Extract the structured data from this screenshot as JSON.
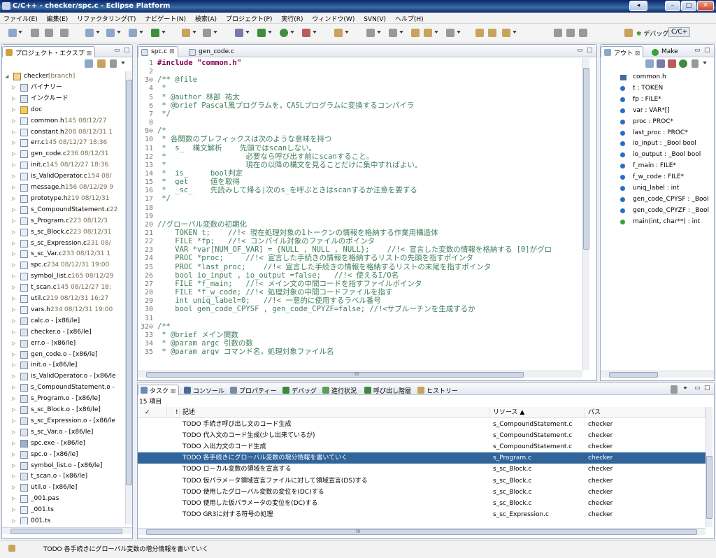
{
  "window": {
    "title": "C/C++ - checker/spc.c - Eclipse Platform",
    "btn_min": "◂",
    "btn_close": "✕"
  },
  "menu": [
    "ファイル(E)",
    "編集(E)",
    "リファクタリング(T)",
    "ナビゲート(N)",
    "検索(A)",
    "プロジェクト(P)",
    "実行(R)",
    "ウィンドウ(W)",
    "SVN(V)",
    "ヘルプ(H)"
  ],
  "perspectives": {
    "debug": "デバッグ",
    "cpp": "C/C+"
  },
  "explorer": {
    "tab": "プロジェクト・エクスプ",
    "items": [
      {
        "label": "checker",
        "deco": " [branch]",
        "indent": 0,
        "icon": "proj",
        "expanded": true
      },
      {
        "label": "バイナリー",
        "deco": "",
        "indent": 1,
        "icon": "bin"
      },
      {
        "label": "インクルード",
        "deco": "",
        "indent": 1,
        "icon": "bin"
      },
      {
        "label": "doc",
        "deco": "",
        "indent": 1,
        "icon": "folder"
      },
      {
        "label": "common.h",
        "deco": " 145  08/12/27",
        "indent": 1,
        "icon": "h"
      },
      {
        "label": "constant.h",
        "deco": " 208  08/12/31 1",
        "indent": 1,
        "icon": "h"
      },
      {
        "label": "err.c",
        "deco": " 145  08/12/27 18:36",
        "indent": 1,
        "icon": "c"
      },
      {
        "label": "gen_code.c",
        "deco": " 236  08/12/31",
        "indent": 1,
        "icon": "c"
      },
      {
        "label": "init.c",
        "deco": " 145  08/12/27 18:36",
        "indent": 1,
        "icon": "c"
      },
      {
        "label": "is_ValidOperator.c",
        "deco": " 154  08/",
        "indent": 1,
        "icon": "c"
      },
      {
        "label": "message.h",
        "deco": " 156  08/12/29 9",
        "indent": 1,
        "icon": "h"
      },
      {
        "label": "prototype.h",
        "deco": " 219  08/12/31",
        "indent": 1,
        "icon": "h"
      },
      {
        "label": "s_CompoundStatement.c",
        "deco": " 22",
        "indent": 1,
        "icon": "c"
      },
      {
        "label": "s_Program.c",
        "deco": " 223  08/12/3",
        "indent": 1,
        "icon": "c"
      },
      {
        "label": "s_sc_Block.c",
        "deco": " 223  08/12/31",
        "indent": 1,
        "icon": "c"
      },
      {
        "label": "s_sc_Expression.c",
        "deco": " 231  08/",
        "indent": 1,
        "icon": "c"
      },
      {
        "label": "s_sc_Var.c",
        "deco": " 233  08/12/31 1",
        "indent": 1,
        "icon": "c"
      },
      {
        "label": "spc.c",
        "deco": " 234  08/12/31 19:00",
        "indent": 1,
        "icon": "c"
      },
      {
        "label": "symbol_list.c",
        "deco": " 165  08/12/29",
        "indent": 1,
        "icon": "c"
      },
      {
        "label": "t_scan.c",
        "deco": " 145  08/12/27 18:",
        "indent": 1,
        "icon": "c"
      },
      {
        "label": "util.c",
        "deco": " 219  08/12/31 16:27",
        "indent": 1,
        "icon": "c"
      },
      {
        "label": "vars.h",
        "deco": " 234  08/12/31 19:00",
        "indent": 1,
        "icon": "h"
      },
      {
        "label": "calc.o - [x86/le]",
        "deco": "",
        "indent": 1,
        "icon": "bin"
      },
      {
        "label": "checker.o - [x86/le]",
        "deco": "",
        "indent": 1,
        "icon": "bin"
      },
      {
        "label": "err.o - [x86/le]",
        "deco": "",
        "indent": 1,
        "icon": "bin"
      },
      {
        "label": "gen_code.o - [x86/le]",
        "deco": "",
        "indent": 1,
        "icon": "bin"
      },
      {
        "label": "init.o - [x86/le]",
        "deco": "",
        "indent": 1,
        "icon": "bin"
      },
      {
        "label": "is_ValidOperator.o - [x86/le",
        "deco": "",
        "indent": 1,
        "icon": "bin"
      },
      {
        "label": "s_CompoundStatement.o -",
        "deco": "",
        "indent": 1,
        "icon": "bin"
      },
      {
        "label": "s_Program.o - [x86/le]",
        "deco": "",
        "indent": 1,
        "icon": "bin"
      },
      {
        "label": "s_sc_Block.o - [x86/le]",
        "deco": "",
        "indent": 1,
        "icon": "bin"
      },
      {
        "label": "s_sc_Expression.o - [x86/le",
        "deco": "",
        "indent": 1,
        "icon": "bin"
      },
      {
        "label": "s_sc_Var.o - [x86/le]",
        "deco": "",
        "indent": 1,
        "icon": "bin"
      },
      {
        "label": "spc.exe - [x86/le]",
        "deco": "",
        "indent": 1,
        "icon": "exe"
      },
      {
        "label": "spc.o - [x86/le]",
        "deco": "",
        "indent": 1,
        "icon": "bin"
      },
      {
        "label": "symbol_list.o - [x86/le]",
        "deco": "",
        "indent": 1,
        "icon": "bin"
      },
      {
        "label": "t_scan.o - [x86/le]",
        "deco": "",
        "indent": 1,
        "icon": "bin"
      },
      {
        "label": "util.o - [x86/le]",
        "deco": "",
        "indent": 1,
        "icon": "bin"
      },
      {
        "label": "_001.pas",
        "deco": "",
        "indent": 1,
        "icon": "h"
      },
      {
        "label": "_001.ts",
        "deco": "",
        "indent": 1,
        "icon": "h"
      },
      {
        "label": "001.ts",
        "deco": "",
        "indent": 1,
        "icon": "h"
      }
    ]
  },
  "editor": {
    "tabs": [
      "spc.c",
      "gen_code.c"
    ],
    "lines": [
      {
        "n": "1",
        "t": "#include \"common.h\"",
        "k": "inc"
      },
      {
        "n": "2",
        "t": "",
        "k": "c"
      },
      {
        "n": "3⊖",
        "t": "/** @file",
        "k": "c"
      },
      {
        "n": "4",
        "t": " *",
        "k": "c"
      },
      {
        "n": "5",
        "t": " * @author 林部 祐太",
        "k": "c"
      },
      {
        "n": "6",
        "t": " * @brief Pascal風プログラムを，CASLプログラムに変換するコンパイラ",
        "k": "c"
      },
      {
        "n": "7",
        "t": " */",
        "k": "c"
      },
      {
        "n": "8",
        "t": "",
        "k": "c"
      },
      {
        "n": "9⊖",
        "t": "/*",
        "k": "c"
      },
      {
        "n": "10",
        "t": " * 各関数のプレフィックスは次のような意味を持つ",
        "k": "c"
      },
      {
        "n": "11",
        "t": " *  s_  構文解析    先頭ではscanしない。",
        "k": "c"
      },
      {
        "n": "12",
        "t": " *                  必要なら呼び出す前にscanすること。",
        "k": "c"
      },
      {
        "n": "13",
        "t": " *                  現在の以降の構文を見ることだけに集中すればよい。",
        "k": "c"
      },
      {
        "n": "14",
        "t": " *  is_     bool判定",
        "k": "c"
      },
      {
        "n": "15",
        "t": " *  get     値を取得",
        "k": "c"
      },
      {
        "n": "16",
        "t": " *  _sc_    先読みして帰る|次のs_を呼ぶときはscanするか注意を要する",
        "k": "c"
      },
      {
        "n": "17",
        "t": " */",
        "k": "c"
      },
      {
        "n": "18",
        "t": "",
        "k": "c"
      },
      {
        "n": "19",
        "t": "",
        "k": "c"
      },
      {
        "n": "20",
        "t": "//グローバル変数の初期化",
        "k": "c"
      },
      {
        "n": "21",
        "t": "    TOKEN t;    //!< 現在処理対象の1トークンの情報を格納する作業用構造体",
        "k": "m"
      },
      {
        "n": "22",
        "t": "    FILE *fp;   //!< コンパイル対象のファイルのポインタ",
        "k": "m"
      },
      {
        "n": "23",
        "t": "    VAR *var[NUM_OF_VAR] = {NULL , NULL , NULL};    //!< 宣言した変数の情報を格納する [0]がグロ",
        "k": "m"
      },
      {
        "n": "24",
        "t": "    PROC *proc;     //!< 宣言した手続きの情報を格納するリストの先頭を指すポインタ",
        "k": "m"
      },
      {
        "n": "25",
        "t": "    PROC *last_proc;    //!< 宣言した手続きの情報を格納するリストの末尾を指すポインタ",
        "k": "m"
      },
      {
        "n": "26",
        "t": "    bool io_input , io_output =false;   //!< 使えるI/O名",
        "k": "m"
      },
      {
        "n": "27",
        "t": "    FILE *f_main;   //!< メイン文の中間コードを指すファイルポインタ",
        "k": "m"
      },
      {
        "n": "28",
        "t": "    FILE *f_w_code; //!< 処理対象の中間コードファイルを指す",
        "k": "m"
      },
      {
        "n": "29",
        "t": "    int uniq_label=0;   //!< 一意的に使用するラベル番号",
        "k": "m"
      },
      {
        "n": "30",
        "t": "    bool gen_code_CPYSF , gen_code_CPYZF=false; //!<サブルーチンを生成するか",
        "k": "m"
      },
      {
        "n": "31",
        "t": "",
        "k": "c"
      },
      {
        "n": "32⊖",
        "t": "/**",
        "k": "c"
      },
      {
        "n": "33",
        "t": " * @brief メイン関数",
        "k": "c"
      },
      {
        "n": "34",
        "t": " * @param argc 引数の数",
        "k": "c"
      },
      {
        "n": "35",
        "t": " * @param argv コマンド名，処理対象ファイル名",
        "k": "c"
      }
    ]
  },
  "outline": {
    "tabs": [
      "アウト",
      "Make"
    ],
    "items": [
      {
        "label": "common.h",
        "kind": "inc"
      },
      {
        "label": "t : TOKEN",
        "kind": "var"
      },
      {
        "label": "fp : FILE*",
        "kind": "var"
      },
      {
        "label": "var : VAR*[]",
        "kind": "var"
      },
      {
        "label": "proc : PROC*",
        "kind": "var"
      },
      {
        "label": "last_proc : PROC*",
        "kind": "var"
      },
      {
        "label": "io_input : _Bool bool",
        "kind": "var"
      },
      {
        "label": "io_output : _Bool bool",
        "kind": "var"
      },
      {
        "label": "f_main : FILE*",
        "kind": "var"
      },
      {
        "label": "f_w_code : FILE*",
        "kind": "var"
      },
      {
        "label": "uniq_label : int",
        "kind": "var"
      },
      {
        "label": "gen_code_CPYSF : _Bool",
        "kind": "var"
      },
      {
        "label": "gen_code_CPYZF : _Bool",
        "kind": "var"
      },
      {
        "label": "main(int, char**) : int",
        "kind": "fn"
      }
    ]
  },
  "bottom": {
    "tabs": [
      "タスク",
      "コンソール",
      "プロパティー",
      "デバッグ",
      "進行状況",
      "呼び出し階層",
      "ヒストリー"
    ],
    "count": "15 項目",
    "headers": {
      "check": "✓",
      "prio": "!",
      "desc": "記述",
      "resource": "リソース ▲",
      "path": "パス"
    },
    "rows": [
      {
        "desc": "TODO 手続き呼び出し文のコード生成",
        "resource": "s_CompoundStatement.c",
        "path": "checker",
        "selected": false
      },
      {
        "desc": "TODO 代入文のコード生成(少し出来ているが)",
        "resource": "s_CompoundStatement.c",
        "path": "checker",
        "selected": false
      },
      {
        "desc": "TODO 入出力文のコード生成",
        "resource": "s_CompoundStatement.c",
        "path": "checker",
        "selected": false
      },
      {
        "desc": "TODO 各手続きにグローバル変数の増分情報を書いていく",
        "resource": "s_Program.c",
        "path": "checker",
        "selected": true
      },
      {
        "desc": "TODO ローカル変数の領域を宣言する",
        "resource": "s_sc_Block.c",
        "path": "checker",
        "selected": false
      },
      {
        "desc": "TODO 仮パラメータ領域宣言ファイルに対して領域宣言(DS)する",
        "resource": "s_sc_Block.c",
        "path": "checker",
        "selected": false
      },
      {
        "desc": "TODO 使用したグローバル変数の変位を(DC)する",
        "resource": "s_sc_Block.c",
        "path": "checker",
        "selected": false
      },
      {
        "desc": "TODO 使用した仮パラメータの変位を(DC)する",
        "resource": "s_sc_Block.c",
        "path": "checker",
        "selected": false
      },
      {
        "desc": "TODO GR3に対する符号の処理",
        "resource": "s_sc_Expression.c",
        "path": "checker",
        "selected": false
      }
    ]
  },
  "status": {
    "text": "TODO 各手続きにグローバル変数の増分情報を書いていく"
  },
  "scroll_marker": "III"
}
